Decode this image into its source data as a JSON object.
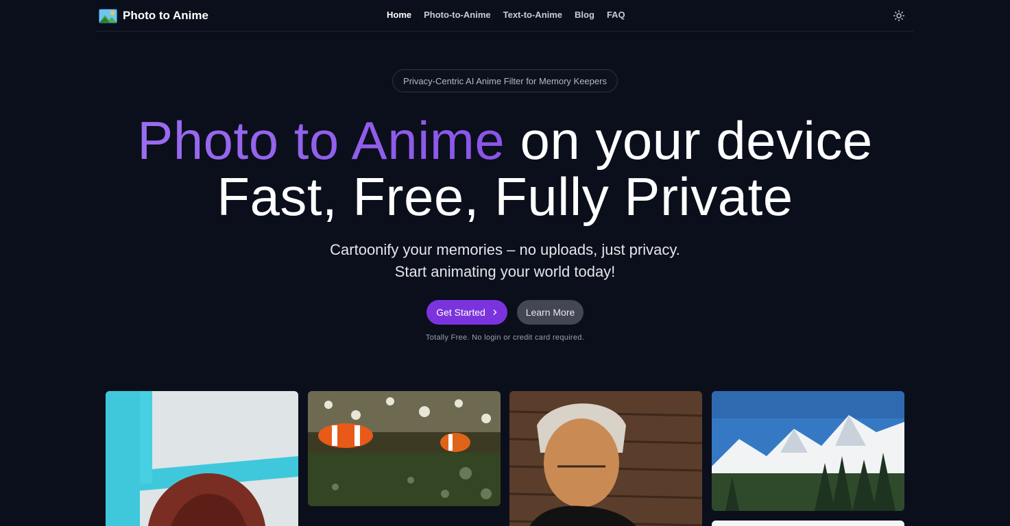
{
  "header": {
    "brand": "Photo to Anime",
    "nav": [
      "Home",
      "Photo-to-Anime",
      "Text-to-Anime",
      "Blog",
      "FAQ"
    ],
    "active_nav": "Home",
    "theme_icon": "sun-icon"
  },
  "hero": {
    "badge": "Privacy-Centric AI Anime Filter for Memory Keepers",
    "headline_accent": "Photo to Anime",
    "headline_rest": "on your device",
    "headline_line2": "Fast, Free, Fully Private",
    "subtitle_line1": "Cartoonify your memories – no uploads, just privacy.",
    "subtitle_line2": "Start animating your world today!",
    "primary_cta": "Get Started",
    "secondary_cta": "Learn More",
    "note": "Totally Free. No login or credit card required."
  },
  "colors": {
    "background": "#0b0f1b",
    "accent": "#7b34dd",
    "headline_gradient": [
      "#9a6cf0",
      "#8a55e8"
    ]
  }
}
